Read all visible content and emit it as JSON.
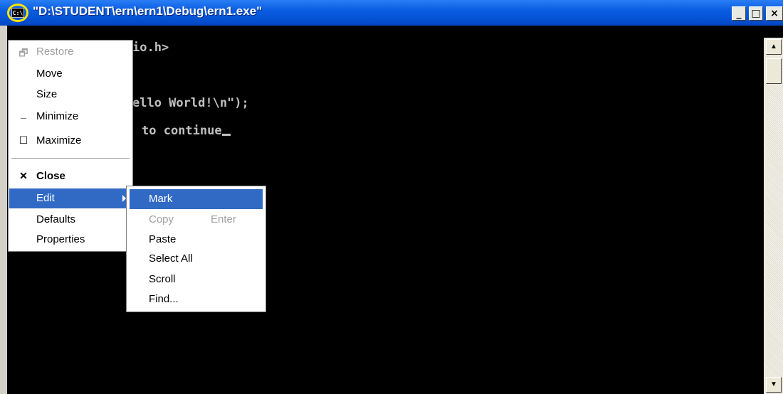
{
  "window": {
    "title": "\"D:\\STUDENT\\ern\\ern1\\Debug\\ern1.exe\"",
    "icon_text": "C:\\",
    "minimize_glyph": "_",
    "maximize_glyph": "□",
    "close_glyph": "×"
  },
  "console": {
    "lines": [
      "io.h>",
      "ello World!\\n\");",
      "to continue"
    ]
  },
  "system_menu": {
    "items": [
      {
        "label": "Restore",
        "icon": "restore-icon",
        "enabled": false
      },
      {
        "label": "Move",
        "icon": "",
        "enabled": true
      },
      {
        "label": "Size",
        "icon": "",
        "enabled": true
      },
      {
        "label": "Minimize",
        "icon": "minimize-icon",
        "enabled": true
      },
      {
        "label": "Maximize",
        "icon": "maximize-icon",
        "enabled": true
      },
      {
        "label": "Close",
        "icon": "close-icon",
        "enabled": true,
        "bold": true
      },
      {
        "label": "Edit",
        "icon": "",
        "enabled": true,
        "highlighted": true,
        "submenu": true
      },
      {
        "label": "Defaults",
        "icon": "",
        "enabled": true
      },
      {
        "label": "Properties",
        "icon": "",
        "enabled": true
      }
    ]
  },
  "edit_submenu": {
    "items": [
      {
        "label": "Mark",
        "enabled": true,
        "highlighted": true
      },
      {
        "label": "Copy",
        "shortcut": "Enter",
        "enabled": false
      },
      {
        "label": "Paste",
        "enabled": true
      },
      {
        "label": "Select All",
        "enabled": true
      },
      {
        "label": "Scroll",
        "enabled": true
      },
      {
        "label": "Find...",
        "enabled": true
      }
    ]
  },
  "colors": {
    "title_bar": "#0553d6",
    "menu_highlight": "#316ac5",
    "console_bg": "#000000",
    "console_text": "#c0c0c0",
    "icon_highlight_ring": "#ffe400"
  }
}
